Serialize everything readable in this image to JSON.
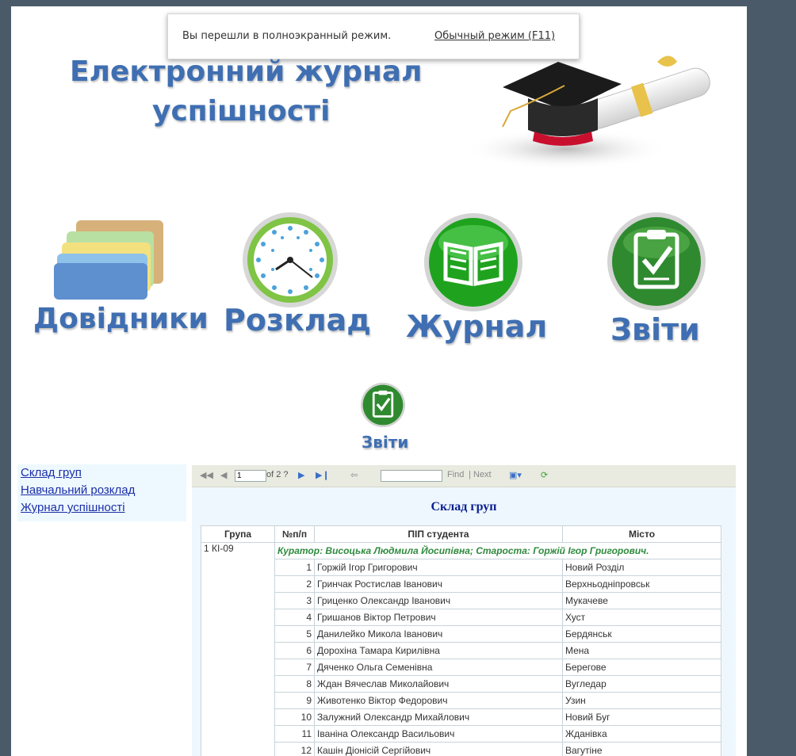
{
  "fullscreen_notice": {
    "message": "Вы перешли в полноэкранный режим.",
    "exit_link": "Обычный режим (F11)"
  },
  "header": {
    "title_line1": "Електронний журнал",
    "title_line2": "успішності"
  },
  "nav": [
    {
      "label": "Довідники",
      "icon": "folders-icon"
    },
    {
      "label": "Розклад",
      "icon": "clock-icon"
    },
    {
      "label": "Журнал",
      "icon": "book-icon"
    },
    {
      "label": "Звіти",
      "icon": "clipboard-check-icon"
    }
  ],
  "small_nav": {
    "label": "Звіти",
    "icon": "clipboard-check-icon"
  },
  "sidebar": {
    "links": [
      "Склад груп",
      "Навчальний розклад",
      "Журнал успішності"
    ]
  },
  "report_toolbar": {
    "page_value": "1",
    "page_of": "of 2 ?",
    "find_label": "Find",
    "separator": "|",
    "next_label": "Next"
  },
  "report": {
    "title": "Склад груп",
    "columns": [
      "Група",
      "№п/п",
      "ПІП студента",
      "Місто"
    ],
    "group": "1 КІ-09",
    "curator_line": "Куратор: Висоцька Людмила Йосипівна; Староста: Горжій Ігор Григорович.",
    "rows": [
      {
        "num": "1",
        "name": "Горжій Ігор Григорович",
        "city": "Новий Розділ"
      },
      {
        "num": "2",
        "name": "Гринчак Ростислав Іванович",
        "city": "Верхньодніпровськ"
      },
      {
        "num": "3",
        "name": "Гриценко Олександр Іванович",
        "city": "Мукачеве"
      },
      {
        "num": "4",
        "name": "Гришанов Віктор Петрович",
        "city": "Хуст"
      },
      {
        "num": "5",
        "name": "Данилейко Микола Іванович",
        "city": "Бердянськ"
      },
      {
        "num": "6",
        "name": "Дорохіна Тамара Кирилівна",
        "city": "Мена"
      },
      {
        "num": "7",
        "name": "Дяченко Ольга Семенівна",
        "city": "Берегове"
      },
      {
        "num": "8",
        "name": "Ждан Вячеслав Миколайович",
        "city": "Вугледар"
      },
      {
        "num": "9",
        "name": "Животенко Віктор Федорович",
        "city": "Узин"
      },
      {
        "num": "10",
        "name": "Залужний Олександр Михайлович",
        "city": "Новий Буг"
      },
      {
        "num": "11",
        "name": "Іваніна Олександр Васильович",
        "city": "Жданівка"
      },
      {
        "num": "12",
        "name": "Кашін Діонісій Сергійович",
        "city": "Вагутіне"
      }
    ]
  },
  "colors": {
    "title_blue": "#3f6fb2",
    "link_blue": "#1a2fa8",
    "curator_green": "#2f8b3e",
    "report_title": "#0a1f8f"
  }
}
